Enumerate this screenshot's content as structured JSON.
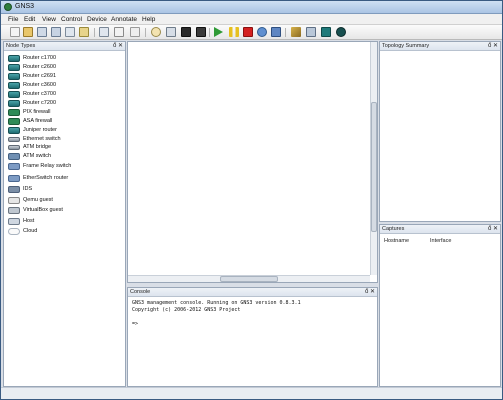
{
  "window": {
    "title": "GNS3"
  },
  "menu": [
    "File",
    "Edit",
    "View",
    "Control",
    "Device",
    "Annotate",
    "Help"
  ],
  "toolbar": {
    "icons": [
      "new-project-icon",
      "open-project-icon",
      "save-project-icon",
      "save-as-icon",
      "import-icon",
      "export-icon",
      "snapshot-icon",
      "fit-view-icon",
      "select-icon",
      "add-link-icon",
      "show-names-icon",
      "console-icon",
      "console-all-icon",
      "terminal-icon",
      "start-icon",
      "suspend-icon",
      "stop-icon",
      "reload-icon",
      "virtualbox-icon",
      "add-note-icon",
      "insert-picture-icon",
      "draw-rectangle-icon",
      "draw-ellipse-icon"
    ]
  },
  "panels": {
    "node_types": {
      "title": "Node Types",
      "buttons": "ő ✕"
    },
    "topology_summary": {
      "title": "Topology Summary",
      "buttons": "ő ✕"
    },
    "captures": {
      "title": "Captures",
      "buttons": "ő ✕",
      "columns": [
        "Hostname",
        "Interface"
      ]
    },
    "console": {
      "title": "Console",
      "buttons": "ő ✕"
    }
  },
  "node_types": [
    {
      "label": "Router c1700",
      "icon": "router-icon"
    },
    {
      "label": "Router c2600",
      "icon": "router-icon"
    },
    {
      "label": "Router c2691",
      "icon": "router-icon"
    },
    {
      "label": "Router c3600",
      "icon": "router-icon"
    },
    {
      "label": "Router c3700",
      "icon": "router-icon"
    },
    {
      "label": "Router c7200",
      "icon": "router-icon"
    },
    {
      "label": "PIX firewall",
      "icon": "firewall-icon"
    },
    {
      "label": "ASA firewall",
      "icon": "firewall-icon"
    },
    {
      "label": "Juniper router",
      "icon": "router-icon"
    },
    {
      "label": "Ethernet switch",
      "icon": "switch-icon"
    },
    {
      "label": "ATM bridge",
      "icon": "switch-icon"
    },
    {
      "label": "ATM switch",
      "icon": "atm-switch-icon"
    },
    {
      "label": "Frame Relay switch",
      "icon": "frame-relay-icon"
    },
    {
      "label": "EtherSwitch router",
      "icon": "etherswitch-icon"
    },
    {
      "label": "IDS",
      "icon": "ids-icon"
    },
    {
      "label": "Qemu guest",
      "icon": "qemu-icon"
    },
    {
      "label": "VirtualBox guest",
      "icon": "virtualbox-icon"
    },
    {
      "label": "Host",
      "icon": "host-icon"
    },
    {
      "label": "Cloud",
      "icon": "cloud-icon"
    }
  ],
  "console": {
    "lines": [
      "GNS3 management console. Running on GNS3 version 0.8.3.1",
      "Copyright (c) 2006-2012 GNS3 Project",
      "",
      "=>"
    ]
  }
}
